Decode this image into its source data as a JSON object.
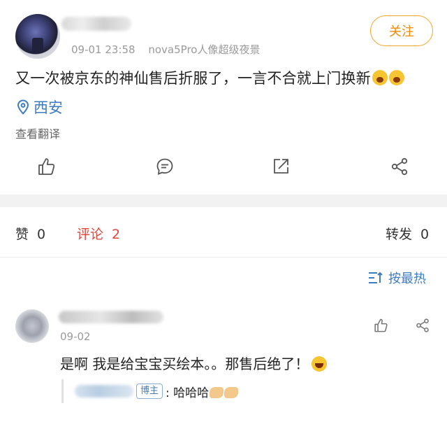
{
  "post": {
    "timestamp": "09-01 23:58",
    "device": "nova5Pro人像超级夜景",
    "follow_label": "关注",
    "text": "又一次被京东的神仙售后折服了，一言不合就上门换新",
    "emoji": [
      "scream-emoji",
      "scream-emoji"
    ],
    "location": "西安",
    "translate_label": "查看翻译",
    "actions": [
      "thumbs-up-icon",
      "comment-icon",
      "repost-icon",
      "share-icon"
    ]
  },
  "stats": {
    "like_label": "赞",
    "like_count": "0",
    "comment_label": "评论",
    "comment_count": "2",
    "repost_label": "转发",
    "repost_count": "0"
  },
  "sort": {
    "label": "按最热"
  },
  "comment": {
    "date": "09-02",
    "text": "是啊 我是给宝宝买绘本。。那售后绝了！",
    "emoji": "laugh-emoji",
    "reply": {
      "badge": "博主",
      "text": ":  哈哈哈"
    }
  },
  "colors": {
    "accent_orange": "#f08a00",
    "link_blue": "#3e7cc1",
    "comment_red": "#e0463b"
  }
}
